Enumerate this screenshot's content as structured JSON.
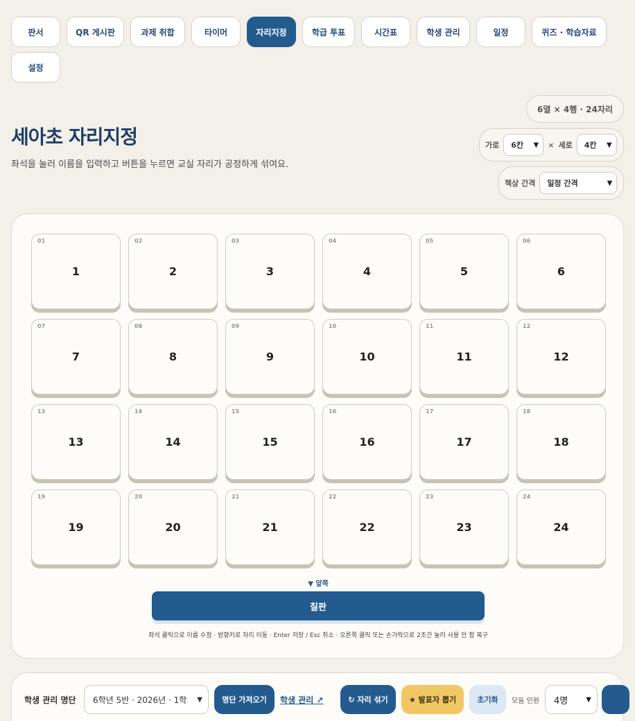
{
  "nav": {
    "tabs": [
      {
        "label": "판서",
        "active": false
      },
      {
        "label": "QR 게시판",
        "active": false
      },
      {
        "label": "과제 취합",
        "active": false
      },
      {
        "label": "타이머",
        "active": false
      },
      {
        "label": "자리지정",
        "active": true
      },
      {
        "label": "학급 투표",
        "active": false
      },
      {
        "label": "시간표",
        "active": false
      },
      {
        "label": "학생 관리",
        "active": false
      },
      {
        "label": "일정",
        "active": false
      },
      {
        "label": "퀴즈 · 학습자료",
        "active": false
      },
      {
        "label": "설정",
        "active": false
      }
    ]
  },
  "header": {
    "title": "세아초 자리지정",
    "subtitle": "좌석을 눌러 이름을 입력하고 버튼을 누르면 교실 자리가 공정하게 섞여요."
  },
  "layout_controls": {
    "summary": "6열 × 4행 · 24자리",
    "cols_label": "가로",
    "cols_value": "6칸",
    "times": "×",
    "rows_label": "세로",
    "rows_value": "4칸",
    "gap_label": "책상 간격",
    "gap_value": "일정 간격"
  },
  "seats": [
    {
      "no": "01",
      "name": "1"
    },
    {
      "no": "02",
      "name": "2"
    },
    {
      "no": "03",
      "name": "3"
    },
    {
      "no": "04",
      "name": "4"
    },
    {
      "no": "05",
      "name": "5"
    },
    {
      "no": "06",
      "name": "6"
    },
    {
      "no": "07",
      "name": "7"
    },
    {
      "no": "08",
      "name": "8"
    },
    {
      "no": "09",
      "name": "9"
    },
    {
      "no": "10",
      "name": "10"
    },
    {
      "no": "11",
      "name": "11"
    },
    {
      "no": "12",
      "name": "12"
    },
    {
      "no": "13",
      "name": "13"
    },
    {
      "no": "14",
      "name": "14"
    },
    {
      "no": "15",
      "name": "15"
    },
    {
      "no": "16",
      "name": "16"
    },
    {
      "no": "17",
      "name": "17"
    },
    {
      "no": "18",
      "name": "18"
    },
    {
      "no": "19",
      "name": "19"
    },
    {
      "no": "20",
      "name": "20"
    },
    {
      "no": "21",
      "name": "21"
    },
    {
      "no": "22",
      "name": "22"
    },
    {
      "no": "23",
      "name": "23"
    },
    {
      "no": "24",
      "name": "24"
    }
  ],
  "board": {
    "front_label": "▼ 앞쪽",
    "chalkboard": "칠판",
    "hint": "좌석 클릭으로 이름 수정 · 방향키로 자리 이동 · Enter 저장 / Esc 취소 · 오른쪽 클릭 또는 손가락으로 2초간 눌러 사용 안 함 복구"
  },
  "toolbar": {
    "roster_label": "학생 관리 명단",
    "roster_value": "6학년 5반 · 2026년 · 1학",
    "import_button": "명단 가져오기",
    "manage_link": "학생 관리 ↗",
    "shuffle_button": "↻ 자리 섞기",
    "presenter_button": "★ 발표자 뽑기",
    "reset_button": "초기화",
    "group_label": "모둠 인원",
    "group_value": "4명"
  },
  "colors": {
    "accent": "#245b8f",
    "background": "#f3f0ea",
    "highlight_yellow": "#f1c766"
  }
}
